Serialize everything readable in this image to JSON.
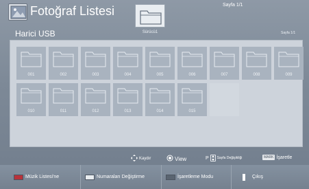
{
  "header": {
    "title": "Fotoğraf Listesi",
    "source": "Harici USB",
    "drive_label": "Sürücü1",
    "page_top": "Sayfa 1/1",
    "page_right": "Sayfa 1/1"
  },
  "folders": [
    "001",
    "002",
    "003",
    "004",
    "005",
    "006",
    "007",
    "008",
    "009",
    "010",
    "011",
    "012",
    "013",
    "014",
    "015"
  ],
  "hints": {
    "move": "Kaydır",
    "view": "View",
    "page_prefix": "P",
    "page_change": "Sayfa Değişikliği",
    "mark_key": "MARK",
    "mark": "İşaretle"
  },
  "bottom_bar": {
    "music_list": "Müzik Listesi'ne",
    "change_numbers": "Numaraları Değiştirme",
    "mark_mode": "İşaretleme Modu",
    "exit": "Çıkış"
  },
  "colors": {
    "red_swatch": "#b8323a",
    "green_swatch": "#e8ecef",
    "yellow_swatch": "#d8dde2",
    "blue_swatch": "#2f6fb5"
  },
  "icons": {
    "app": "photo-icon",
    "drive": "folder-icon",
    "tiles": "folder-icon",
    "move": "four-way-arrow-icon",
    "view": "ok-button-icon",
    "page": "page-up-down-icon",
    "exit": "exit-icon"
  }
}
